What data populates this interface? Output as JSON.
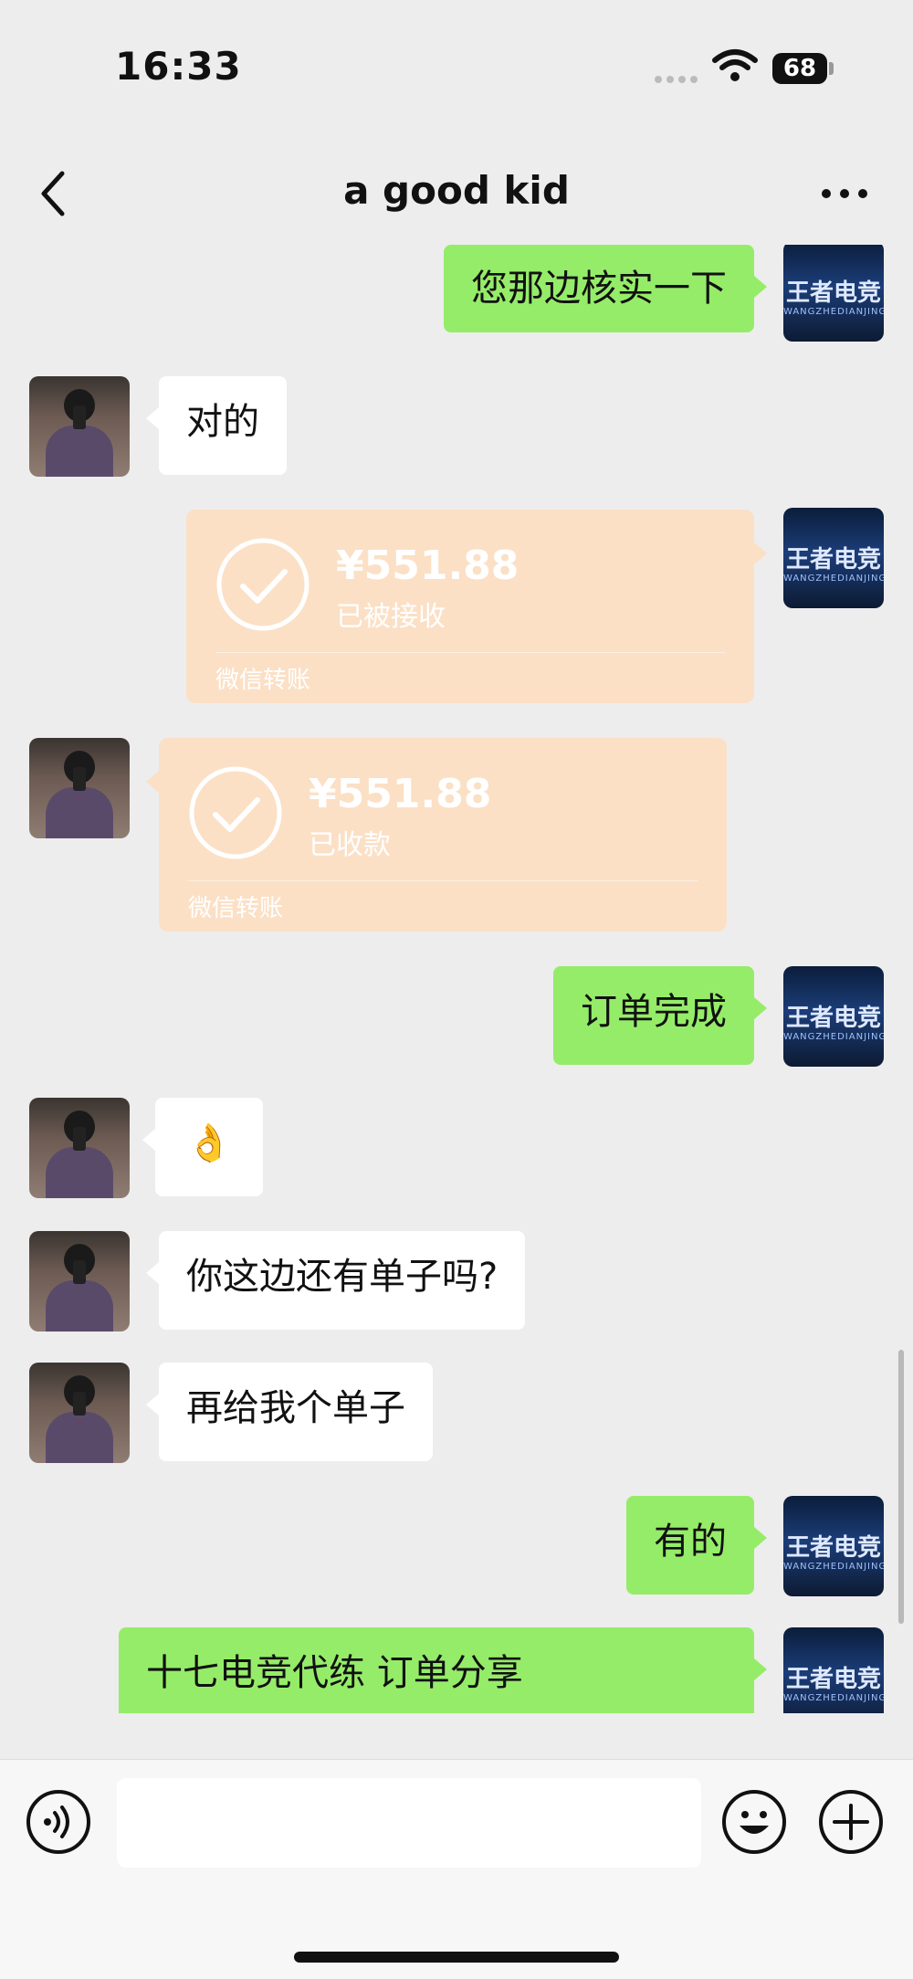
{
  "status_bar": {
    "time": "16:33",
    "battery": "68"
  },
  "nav": {
    "title": "a good kid"
  },
  "messages": {
    "m1": "您那边核实一下",
    "m2": "对的",
    "t1": {
      "amount": "¥551.88",
      "status": "已被接收",
      "source": "微信转账"
    },
    "t2": {
      "amount": "¥551.88",
      "status": "已收款",
      "source": "微信转账"
    },
    "m3": "订单完成",
    "m4": "👌",
    "m5": "你这边还有单子吗?",
    "m6": "再给我个单子",
    "m7": "有的",
    "m8": "十七电竞代练  订单分享"
  },
  "avatars": {
    "self_logo": "王者电竞",
    "self_logo_sub": "WANGZHEDIANJING"
  },
  "colors": {
    "self_bubble": "#95ec69",
    "other_bubble": "#ffffff",
    "transfer_received": "#fbe0c6",
    "background": "#ededed"
  },
  "icons": [
    "back-chevron-icon",
    "more-dots-icon",
    "voice-icon",
    "emoji-icon",
    "plus-icon",
    "wifi-icon",
    "check-circle-icon"
  ]
}
